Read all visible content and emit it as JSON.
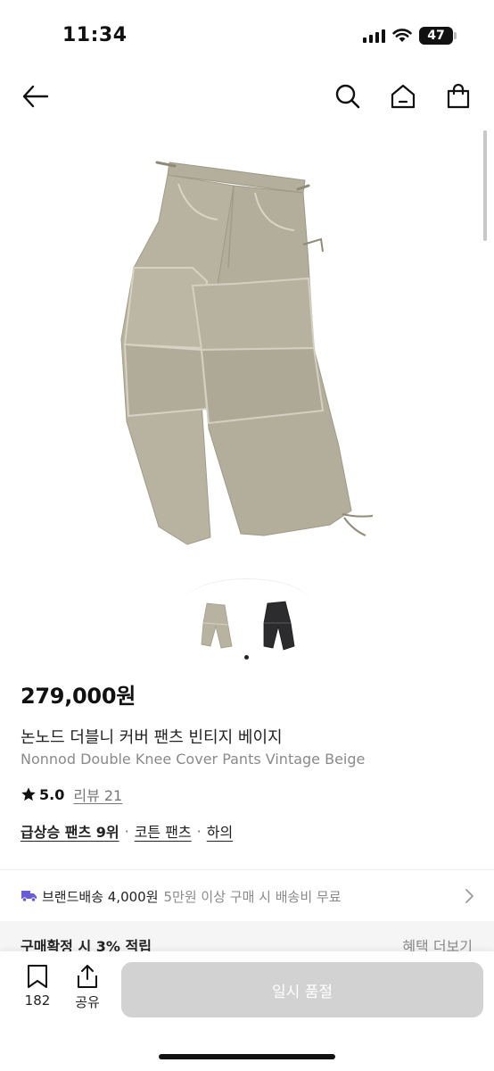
{
  "status_bar": {
    "time": "11:34",
    "battery": "47"
  },
  "nav": {
    "icons": [
      "back-arrow-icon",
      "search-icon",
      "home-icon",
      "shopping-bag-icon"
    ]
  },
  "gallery": {
    "thumbnails": [
      "beige-pants-thumbnail",
      "black-pants-thumbnail"
    ],
    "active_index": 0
  },
  "product": {
    "price": "279,000원",
    "title_ko": "논노드 더블니 커버 팬츠 빈티지 베이지",
    "title_en": "Nonnod Double Knee Cover Pants Vintage Beige",
    "rating": "5.0",
    "review": "리뷰 21",
    "categories": [
      "급상승 팬츠 9위",
      "코튼 팬츠",
      "하의"
    ],
    "separator": "·"
  },
  "shipping": {
    "label": "브랜드배송 4,000원",
    "note": "5만원 이상 구매 시 배송비 무료"
  },
  "benefit": {
    "title": "구매확정 시 3% 적립",
    "more": "혜택 더보기"
  },
  "bottom_bar": {
    "bookmark_count": "182",
    "share_label": "공유",
    "buy_label": "일시 품절"
  },
  "colors": {
    "accent_purple": "#6a5cd6",
    "button_disabled": "#d2d2d2",
    "pants_beige": "#b7b29f",
    "star": "#111111"
  }
}
